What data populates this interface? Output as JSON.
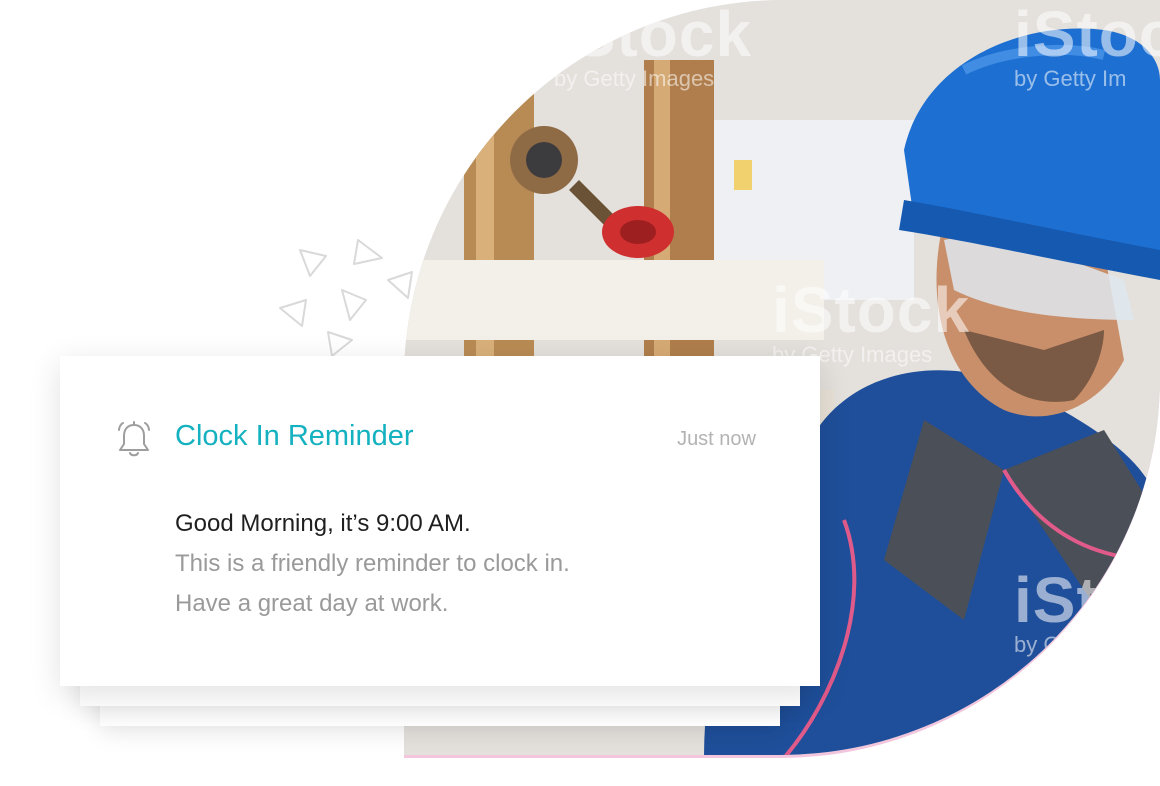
{
  "notification": {
    "title": "Clock In Reminder",
    "timestamp": "Just now",
    "greeting": "Good Morning, it’s 9:00 AM.",
    "message_line1": "This is a friendly reminder to clock in.",
    "message_line2": "Have a great day at work.",
    "icon": "bell-icon",
    "accent_color": "#14b1c0"
  },
  "photo": {
    "watermark_brand": "iStock",
    "watermark_sub": "by Getty Images",
    "watermark_sub_partial": "by Getty Im",
    "watermark_sub_short": "by Get"
  },
  "colors": {
    "title": "#14b1c0",
    "timestamp": "#b3b3b3",
    "text_primary": "#1f1f1f",
    "text_secondary": "#9a9a9a",
    "photo_border": "#f3c6dd"
  }
}
